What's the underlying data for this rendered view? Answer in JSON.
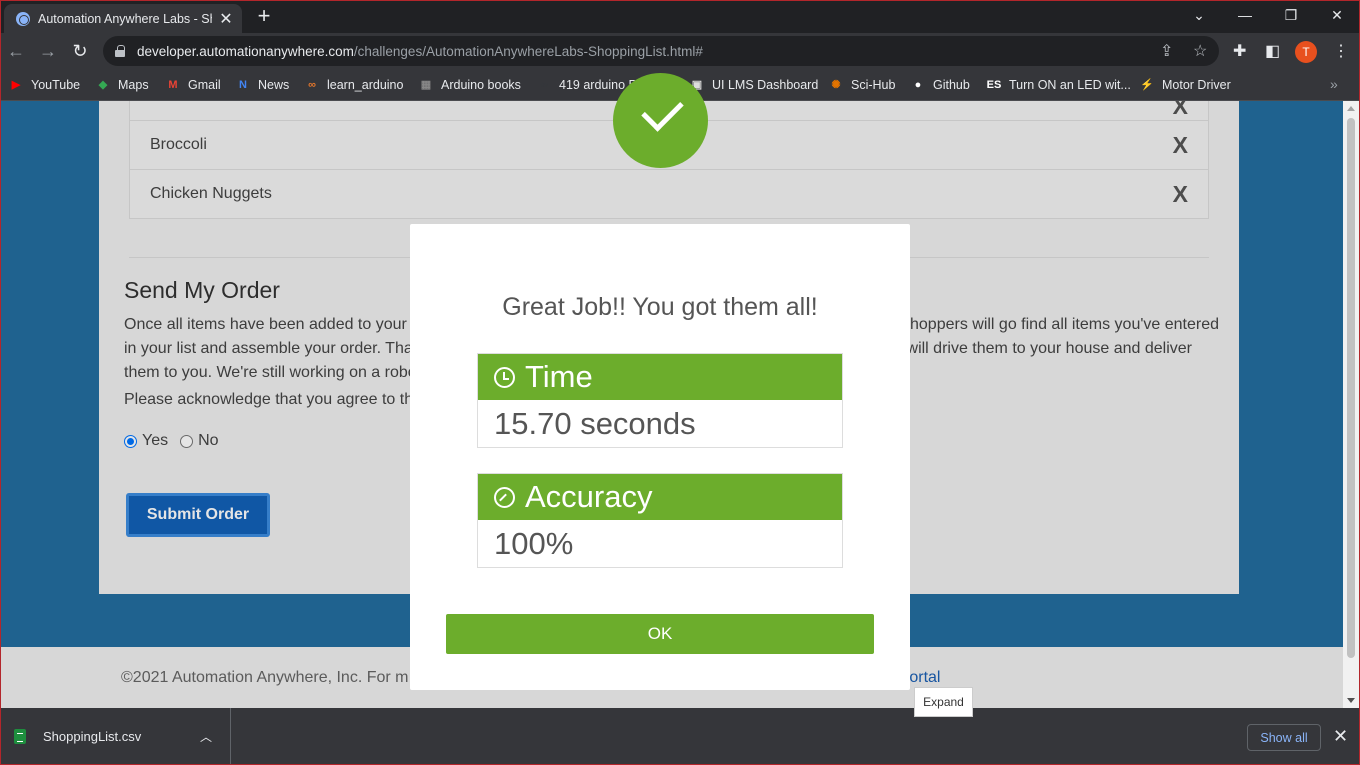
{
  "browser": {
    "tab_title": "Automation Anywhere Labs - Shopping List",
    "url_host": "developer.automationanywhere.com",
    "url_path": "/challenges/AutomationAnywhereLabs-ShoppingList.html#",
    "avatar_letter": "T",
    "bookmarks": [
      {
        "label": "YouTube",
        "icon": "youtube-icon",
        "color": "#ff0000"
      },
      {
        "label": "Maps",
        "icon": "maps-icon",
        "color": "#34a853"
      },
      {
        "label": "Gmail",
        "icon": "gmail-icon",
        "color": "#ea4335"
      },
      {
        "label": "News",
        "icon": "news-icon",
        "color": "#4285f4"
      },
      {
        "label": "learn_arduino",
        "icon": "arduino-icon",
        "color": "#e2762c"
      },
      {
        "label": "Arduino books",
        "icon": "book-icon",
        "color": "#888888"
      },
      {
        "label": "419 arduino Project...",
        "icon": "infinity-icon",
        "color": "#35363a"
      },
      {
        "label": "UI LMS Dashboard",
        "icon": "lms-icon",
        "color": "#dddddd"
      },
      {
        "label": "Sci-Hub",
        "icon": "scihub-icon",
        "color": "#e37400"
      },
      {
        "label": "Github",
        "icon": "github-icon",
        "color": "#ffffff"
      },
      {
        "label": "Turn ON an LED wit...",
        "icon": "es-icon",
        "color": "#ffffff"
      },
      {
        "label": "Motor Driver",
        "icon": "motor-icon",
        "color": "#f9ab00"
      }
    ]
  },
  "page": {
    "list_items": [
      {
        "name": "",
        "remove": "X"
      },
      {
        "name": "Broccoli",
        "remove": "X"
      },
      {
        "name": "Chicken Nuggets",
        "remove": "X"
      }
    ],
    "send_title": "Send My Order",
    "send_paragraph_start": "Once all items have been added to your",
    "send_paragraph_end": "hoppers will go find all items you've entered",
    "send_line2_start": "in your list and assemble your order. Tha",
    "send_line2_end": "will drive them to your house and deliver",
    "send_line3": "them to you. We're still working on a robo",
    "ack_text": "Please acknowledge that you agree to th",
    "radio_yes": "Yes",
    "radio_no": "No",
    "submit_label": "Submit Order",
    "footer_text": "©2021 Automation Anywhere, Inc. For m",
    "footer_link": "er Portal"
  },
  "modal": {
    "title": "Great Job!! You got them all!",
    "time_label": "Time",
    "time_value": "15.70 seconds",
    "accuracy_label": "Accuracy",
    "accuracy_value": "100%",
    "ok_label": "OK"
  },
  "tooltip": "Expand",
  "downloads": {
    "file_name": "ShoppingList.csv",
    "show_all": "Show all"
  }
}
